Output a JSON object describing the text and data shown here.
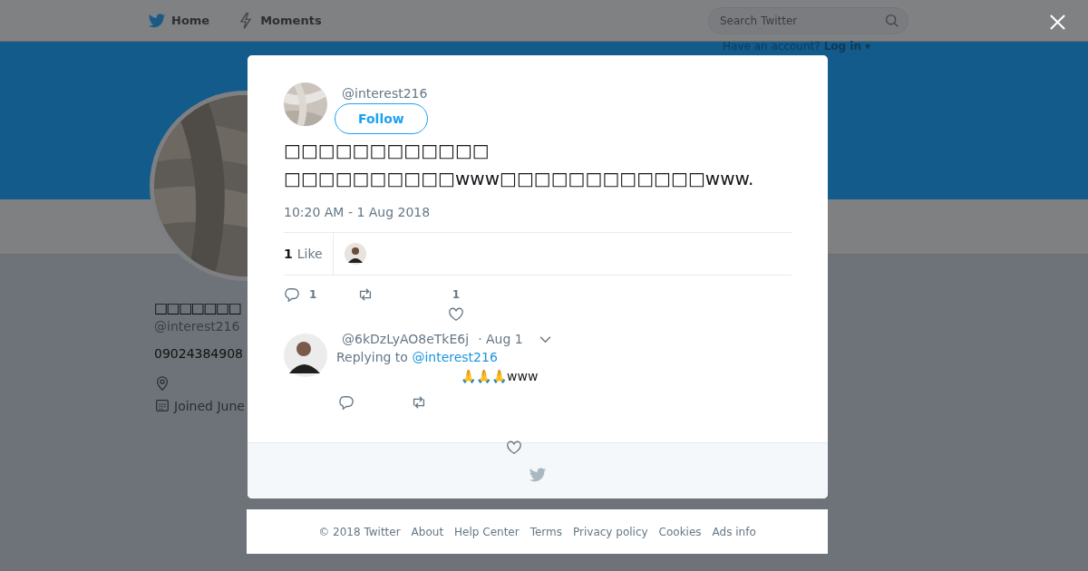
{
  "nav": {
    "items": [
      {
        "label": "Home",
        "kind": "bird"
      },
      {
        "label": "Moments",
        "kind": "bolt"
      }
    ],
    "search": {
      "placeholder": "Search Twitter"
    },
    "login_prompt": {
      "text": "Have an account?",
      "link": "Log in ▾"
    }
  },
  "profile": {
    "name": "□□□□□□□",
    "handle": "@interest216",
    "phone": "09024384908",
    "joined": "Joined June"
  },
  "tweet": {
    "handle": "@interest216",
    "follow_label": "Follow",
    "text_lines": [
      "□□□□□□□□□□□□",
      "□□□□□□□□□□www□□□□□□□□□□□□www."
    ],
    "timestamp": "10:20 AM - 1 Aug 2018",
    "likes": {
      "count": "1",
      "label": "Like"
    },
    "actions": {
      "replies": "1",
      "likes": "1"
    }
  },
  "reply": {
    "handle": "@6kDzLyAO8eTkE6j",
    "date": "· Aug 1",
    "replying_label": "Replying to",
    "replying_to": "@interest216",
    "text": "🙏🙏🙏www"
  },
  "footer": [
    "© 2018 Twitter",
    "About",
    "Help Center",
    "Terms",
    "Privacy policy",
    "Cookies",
    "Ads info"
  ]
}
